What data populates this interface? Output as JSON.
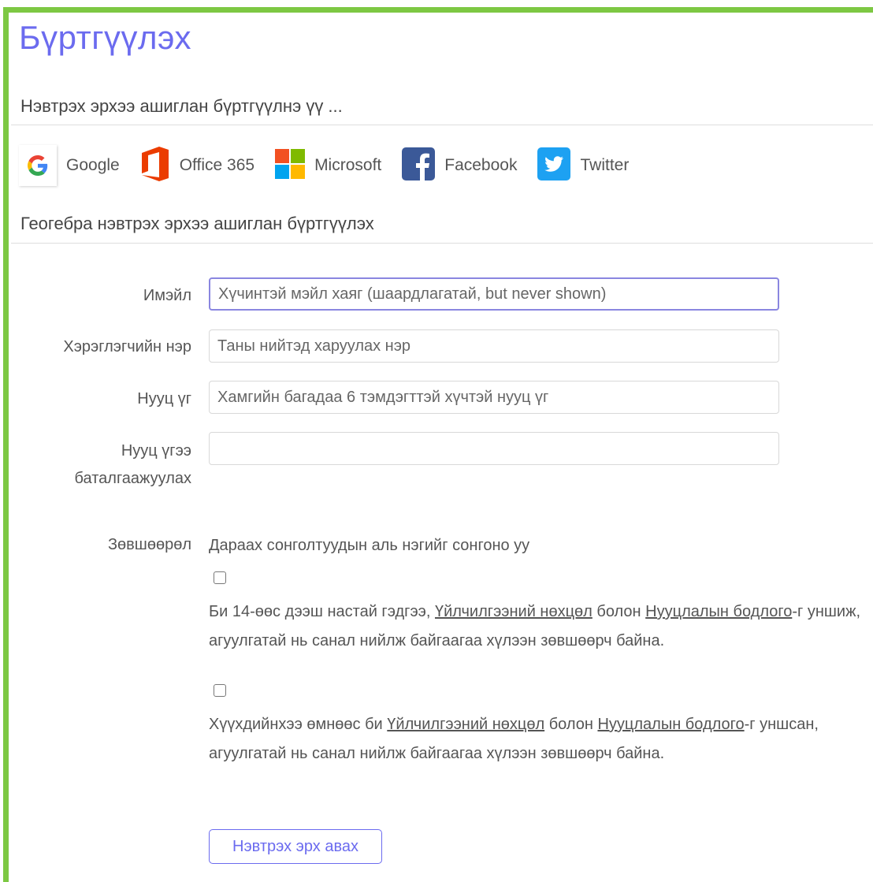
{
  "title": "Бүртгүүлэх",
  "social": {
    "heading": "Нэвтрэх эрхээ ашиглан бүртгүүлнэ үү ...",
    "providers": [
      {
        "label": "Google",
        "icon": "google-icon"
      },
      {
        "label": "Office 365",
        "icon": "office365-icon"
      },
      {
        "label": "Microsoft",
        "icon": "microsoft-icon"
      },
      {
        "label": "Facebook",
        "icon": "facebook-icon"
      },
      {
        "label": "Twitter",
        "icon": "twitter-icon"
      }
    ]
  },
  "form": {
    "heading": "Геогебра нэвтрэх эрхээ ашиглан бүртгүүлэх",
    "email": {
      "label": "Имэйл",
      "placeholder": "Хүчинтэй мэйл хаяг (шаардлагатай, but never shown)"
    },
    "username": {
      "label": "Хэрэглэгчийн нэр",
      "placeholder": "Таны нийтэд харуулах нэр"
    },
    "password": {
      "label": "Нууц үг",
      "placeholder": "Хамгийн багадаа 6 тэмдэгттэй хүчтэй нууц үг"
    },
    "confirm": {
      "label_line1": "Нууц үгээ",
      "label_line2": "баталгаажуулах",
      "placeholder": ""
    },
    "consent": {
      "label": "Зөвшөөрөл",
      "intro": "Дараах сонголтуудын аль нэгийг сонгоно уу",
      "option1": {
        "before": "Би 14-өөс дээш настай гэдгээ, ",
        "terms_link": "Үйлчилгээний нөхцөл",
        "middle": " болон ",
        "privacy_link": "Нууцлалын бодлого",
        "after": "-г уншиж, агуулгатай нь санал нийлж байгаагаа хүлээн зөвшөөрч байна."
      },
      "option2": {
        "before": "Хүүхдийнхээ өмнөөс би ",
        "terms_link": "Үйлчилгээний нөхцөл",
        "middle": " болон ",
        "privacy_link": "Нууцлалын бодлого",
        "after": "-г уншсан, агуулгатай нь санал нийлж байгаагаа хүлээн зөвшөөрч байна."
      }
    },
    "submit_label": "Нэвтрэх эрх авах"
  },
  "colors": {
    "frame": "#7dc843",
    "accent": "#6b6bef",
    "google_blue": "#4285f4",
    "office_red": "#eb3c00",
    "facebook_blue": "#3b5998",
    "twitter_blue": "#1da1f2"
  }
}
